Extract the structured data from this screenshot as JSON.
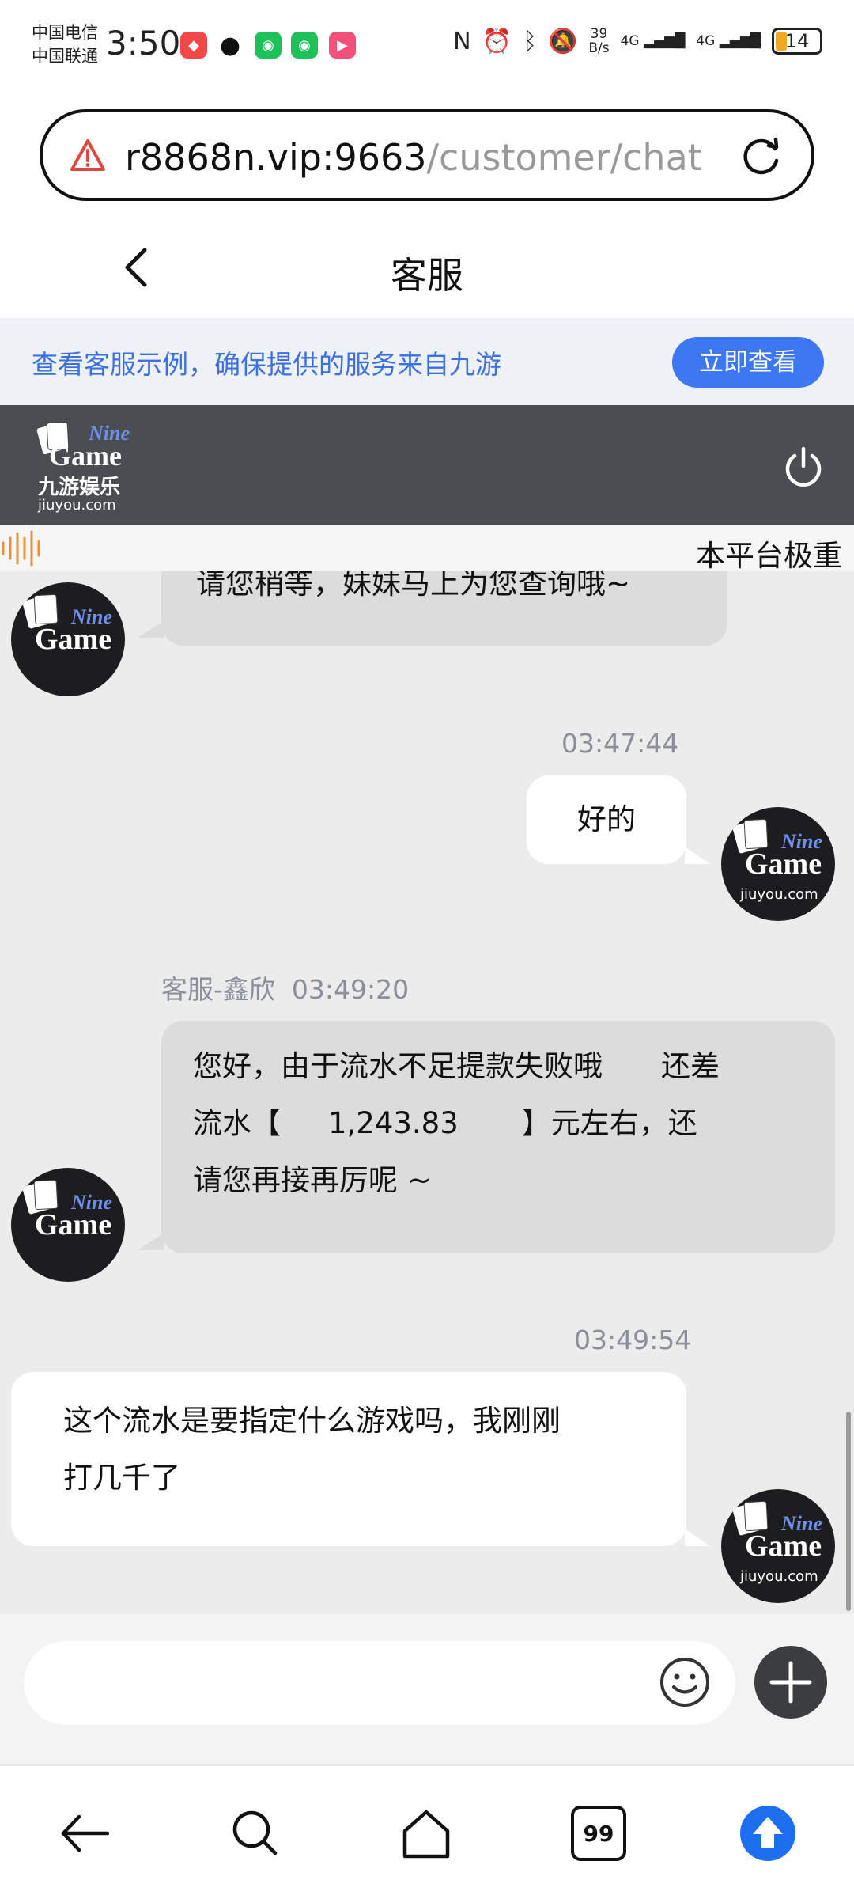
{
  "status_bar": {
    "carrier_1": "中国电信",
    "carrier_2": "中国联通",
    "time": "3:50",
    "net_speed_value": "39",
    "net_speed_unit": "B/s",
    "signal_1": "4G",
    "signal_2": "4G",
    "battery": "14"
  },
  "url_bar": {
    "host": "r8868n.vip:9663",
    "path": "/customer/chat"
  },
  "title_bar": {
    "title": "客服"
  },
  "notice": {
    "text": "查看客服示例，确保提供的服务来自九游",
    "button": "立即查看"
  },
  "header": {
    "logo_nine": "Nine",
    "logo_game": "Game",
    "logo_cn": "九游娱乐",
    "logo_domain": "jiuyou.com"
  },
  "marquee": {
    "text": "本平台极重"
  },
  "chat": {
    "messages": [
      {
        "from": "agent",
        "text": "请您稍等，妹妹马上为您查询哦~"
      },
      {
        "from": "user",
        "time": "03:47:44",
        "text": "好的"
      },
      {
        "from": "agent",
        "sender": "客服-鑫欣",
        "time": "03:49:20",
        "line1": "您好，由于流水不足提款失败哦　　还差",
        "line2_start": "流水【",
        "amount": "1,243.83",
        "line2_end": "】元左右，还",
        "line3": "请您再接再厉呢 ~"
      },
      {
        "from": "user",
        "time": "03:49:54",
        "line1": "这个流水是要指定什么游戏吗，我刚刚",
        "line2": "打几千了"
      }
    ]
  },
  "input": {
    "placeholder": ""
  },
  "colors": {
    "accent": "#3d78f2",
    "header_bg": "#4a4d52",
    "chat_bg": "#ececec",
    "agent_bubble": "#dcdcdc",
    "user_bubble": "#ffffff",
    "warning": "#e0483e"
  },
  "icons": {
    "warning": "warning-icon",
    "reload": "reload-icon",
    "back": "back-arrow-icon",
    "power": "power-icon",
    "sound": "sound-wave-icon",
    "emoji": "emoji-icon",
    "plus": "plus-icon",
    "nav": [
      "back-icon",
      "search-icon",
      "home-icon",
      "tabs-icon",
      "upload-icon"
    ]
  },
  "browser_nav": {
    "tab_count": "99"
  }
}
